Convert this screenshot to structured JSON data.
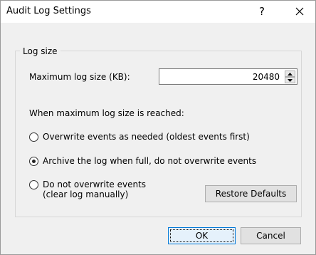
{
  "window": {
    "title": "Audit Log Settings",
    "help_label": "?",
    "close_icon": "close-icon"
  },
  "group": {
    "label": "Log size"
  },
  "max_size": {
    "label": "Maximum log size (KB):",
    "value": "20480"
  },
  "when_full_label": "When maximum log size is reached:",
  "options": [
    {
      "label": "Overwrite events as needed (oldest events first)",
      "selected": false
    },
    {
      "label": "Archive the log when full, do not overwrite events",
      "selected": true
    },
    {
      "label_line1": "Do not overwrite events",
      "label_line2": "(clear log manually)",
      "selected": false
    }
  ],
  "buttons": {
    "restore": "Restore Defaults",
    "ok": "OK",
    "cancel": "Cancel"
  }
}
